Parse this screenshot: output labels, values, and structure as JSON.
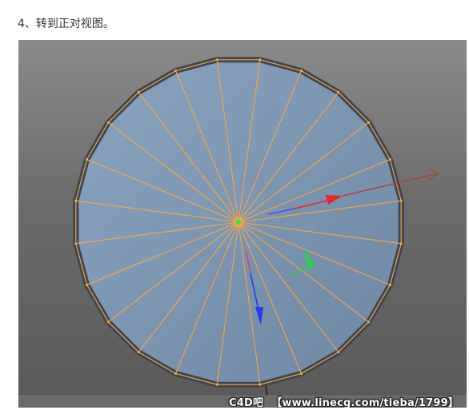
{
  "article": {
    "step_caption": "4、转到正对视图。"
  },
  "viewport": {
    "background_color": "#6f6f6f",
    "polygon_fill": "#7d95b0",
    "edge_color": "#f3a54a",
    "outline_color": "#3f4650",
    "axis_colors": {
      "x": "#e0292a",
      "y": "#2fcf4a",
      "z": "#2b3cf2"
    },
    "object_center_color": "#3fe23f",
    "segment_count": 24
  },
  "watermark": {
    "site_name": "C4D吧",
    "url": "【www.linecg.com/tieba/1799】"
  }
}
